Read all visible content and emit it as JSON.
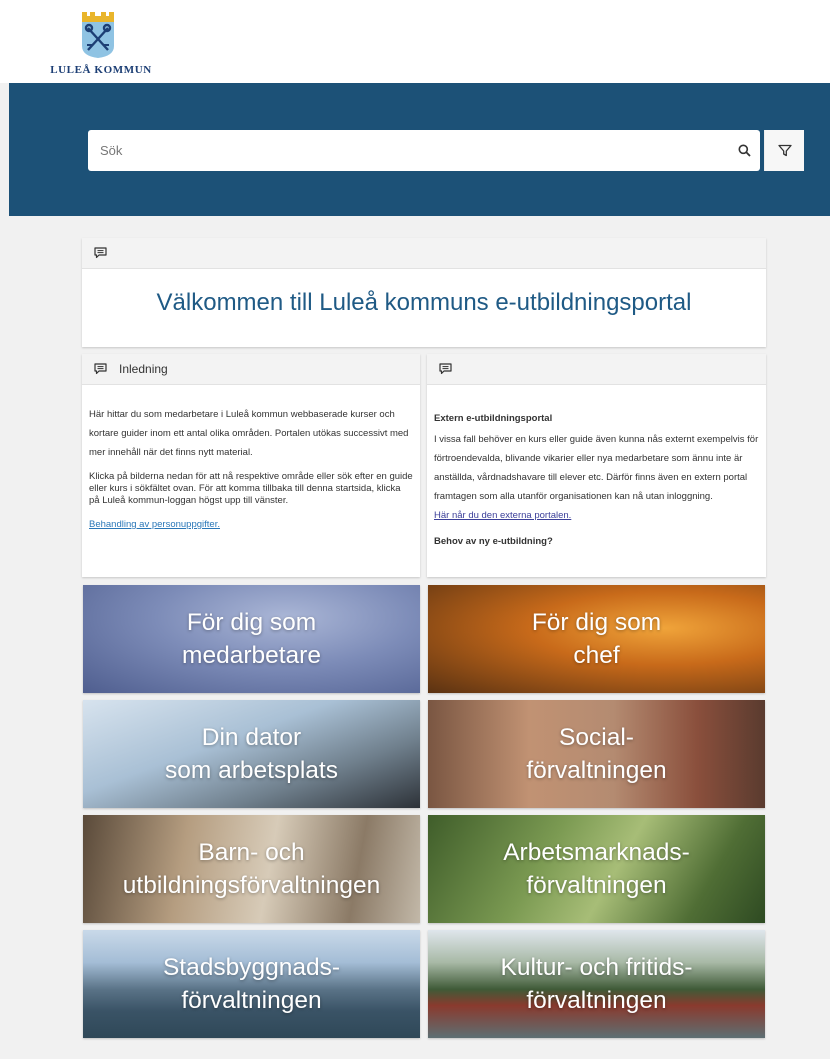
{
  "header": {
    "logo_text": "LULEÅ KOMMUN"
  },
  "search": {
    "placeholder": "Sök"
  },
  "welcome": {
    "title": "Välkommen till Luleå kommuns e-utbildningsportal"
  },
  "intro": {
    "heading": "Inledning",
    "paragraph1": "Här hittar du som medarbetare i Luleå kommun webbaserade kurser och kortare guider inom ett antal olika områden. Portalen utökas successivt med mer innehåll när det finns nytt material.",
    "paragraph2": "Klicka på bilderna nedan för att nå respektive område eller sök efter en guide eller kurs i sökfältet ovan. För att komma tillbaka till denna startsida, klicka på Luleå kommun-loggan högst upp till vänster.",
    "link": "Behandling av personuppgifter."
  },
  "extern": {
    "heading": "",
    "subheading": "Extern e-utbildningsportal",
    "paragraph": "I vissa fall behöver en kurs eller guide även kunna nås externt exempelvis för förtroendevalda, blivande vikarier eller nya medarbetare som ännu inte är anställda, vårdnadshavare till elever etc. Därför finns även en extern portal framtagen som alla utanför organisationen kan nå utan inloggning.",
    "link": "Här når du den externa portalen.",
    "subheading2": "Behov av ny e-utbildning?"
  },
  "tiles": [
    {
      "label": "För dig som\nmedarbetare"
    },
    {
      "label": "För dig som\nchef"
    },
    {
      "label": "Din dator\nsom arbetsplats"
    },
    {
      "label": "Social-\nförvaltningen"
    },
    {
      "label": "Barn- och\nutbildningsförvaltningen"
    },
    {
      "label": "Arbetsmarknads-\nförvaltningen"
    },
    {
      "label": "Stadsbyggnads-\nförvaltningen"
    },
    {
      "label": "Kultur- och fritids-\nförvaltningen"
    }
  ],
  "colors": {
    "hero_bg": "#1c5177",
    "title_blue": "#1f5a85",
    "link_blue": "#2a77b8"
  },
  "icons": {
    "search": "search-icon",
    "filter": "filter-icon",
    "comment": "comment-icon",
    "logo": "crest-icon"
  }
}
